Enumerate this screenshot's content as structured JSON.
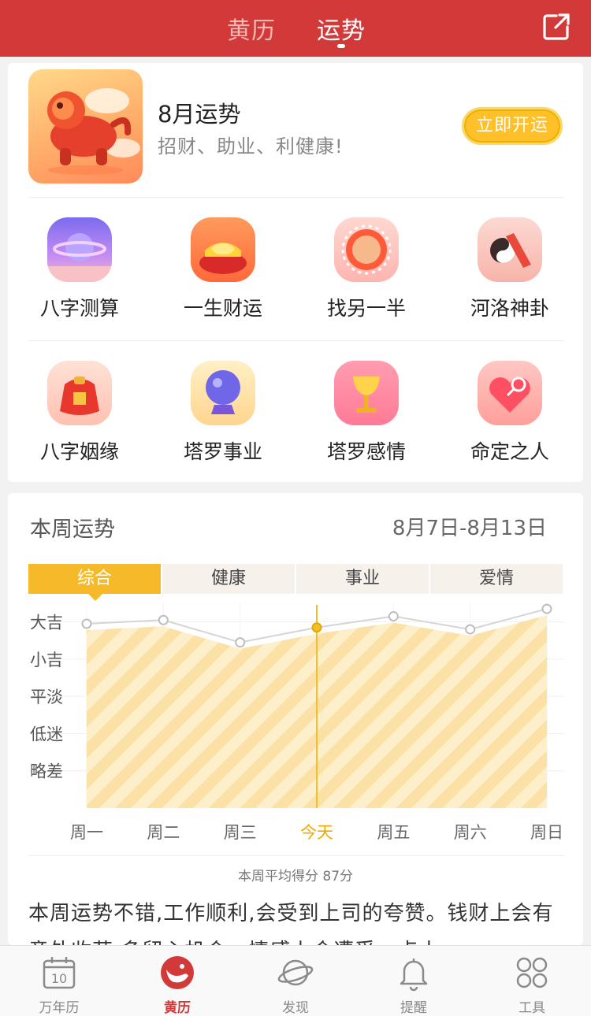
{
  "header": {
    "tabs": [
      {
        "label": "黄历"
      },
      {
        "label": "运势"
      }
    ],
    "active_tab": "运势",
    "share_icon": "share-external-icon"
  },
  "banner": {
    "title": "8月运势",
    "subtitle": "招财、助业、利健康!",
    "button": "立即开运",
    "image_icon": "lion-mascot-icon"
  },
  "services": [
    {
      "label": "八字测算",
      "icon": "planet-icon"
    },
    {
      "label": "一生财运",
      "icon": "gold-ingot-icon"
    },
    {
      "label": "找另一半",
      "icon": "flower-heart-icon"
    },
    {
      "label": "河洛神卦",
      "icon": "yin-yang-scroll-icon"
    },
    {
      "label": "八字姻缘",
      "icon": "double-happiness-bag-icon"
    },
    {
      "label": "塔罗事业",
      "icon": "crystal-ball-icon"
    },
    {
      "label": "塔罗感情",
      "icon": "golden-cup-icon"
    },
    {
      "label": "命定之人",
      "icon": "heart-magnifier-icon"
    }
  ],
  "weekly": {
    "title": "本周运势",
    "range": "8月7日-8月13日",
    "tabs": [
      "综合",
      "健康",
      "事业",
      "爱情"
    ],
    "active_tab": "综合",
    "average_text": "本周平均得分 87分",
    "description": "本周运势不错,工作顺利,会受到上司的夸赞。钱财上会有意外收获,多留心机会。情感上会遭受一点小"
  },
  "chart_data": {
    "type": "area",
    "categories": [
      "周一",
      "周二",
      "周三",
      "今天",
      "周五",
      "周六",
      "周日"
    ],
    "highlight": "今天",
    "y_levels": [
      "大吉",
      "小吉",
      "平淡",
      "低迷",
      "略差"
    ],
    "series": [
      {
        "values": [
          4.95,
          5.05,
          4.45,
          4.85,
          5.15,
          4.8,
          5.35
        ]
      }
    ],
    "ylim": [
      0,
      5.5
    ],
    "colors": {
      "line": "#d5d5d5",
      "fill": "#fde9b7",
      "highlight": "#f4be2a",
      "today_text": "#f0a900"
    }
  },
  "bottom_nav": [
    {
      "label": "万年历",
      "icon": "calendar-10-icon"
    },
    {
      "label": "黄历",
      "icon": "yin-yang-red-icon"
    },
    {
      "label": "发现",
      "icon": "planet-outline-icon"
    },
    {
      "label": "提醒",
      "icon": "bell-icon"
    },
    {
      "label": "工具",
      "icon": "grid-circles-icon"
    }
  ],
  "bottom_active": "黄历",
  "colors": {
    "brand": "#d23a3a",
    "accent": "#f6b92a"
  }
}
